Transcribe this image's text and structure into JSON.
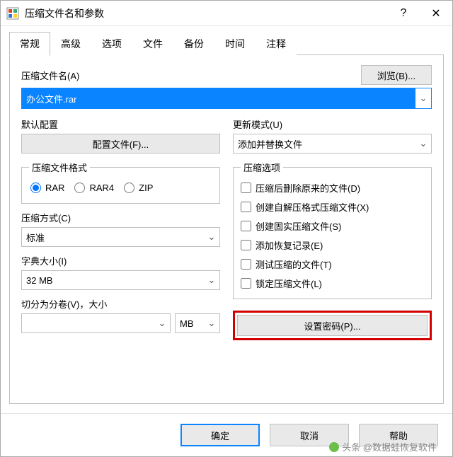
{
  "titlebar": {
    "title": "压缩文件名和参数",
    "help": "?",
    "close": "✕"
  },
  "tabs": [
    "常规",
    "高级",
    "选项",
    "文件",
    "备份",
    "时间",
    "注释"
  ],
  "archive": {
    "label": "压缩文件名(A)",
    "value": "办公文件.rar",
    "browse": "浏览(B)..."
  },
  "profile": {
    "label": "默认配置",
    "button": "配置文件(F)..."
  },
  "update": {
    "label": "更新模式(U)",
    "value": "添加并替换文件"
  },
  "format": {
    "label": "压缩文件格式",
    "options": [
      "RAR",
      "RAR4",
      "ZIP"
    ],
    "selected": "RAR"
  },
  "method": {
    "label": "压缩方式(C)",
    "value": "标准"
  },
  "dict": {
    "label": "字典大小(I)",
    "value": "32 MB"
  },
  "split": {
    "label": "切分为分卷(V)，大小",
    "value": "",
    "unit": "MB"
  },
  "options": {
    "label": "压缩选项",
    "items": [
      "压缩后删除原来的文件(D)",
      "创建自解压格式压缩文件(X)",
      "创建固实压缩文件(S)",
      "添加恢复记录(E)",
      "测试压缩的文件(T)",
      "锁定压缩文件(L)"
    ]
  },
  "password": "设置密码(P)...",
  "footer": {
    "ok": "确定",
    "cancel": "取消",
    "help": "帮助"
  },
  "watermark": "头条 @数据蛙恢复软件"
}
